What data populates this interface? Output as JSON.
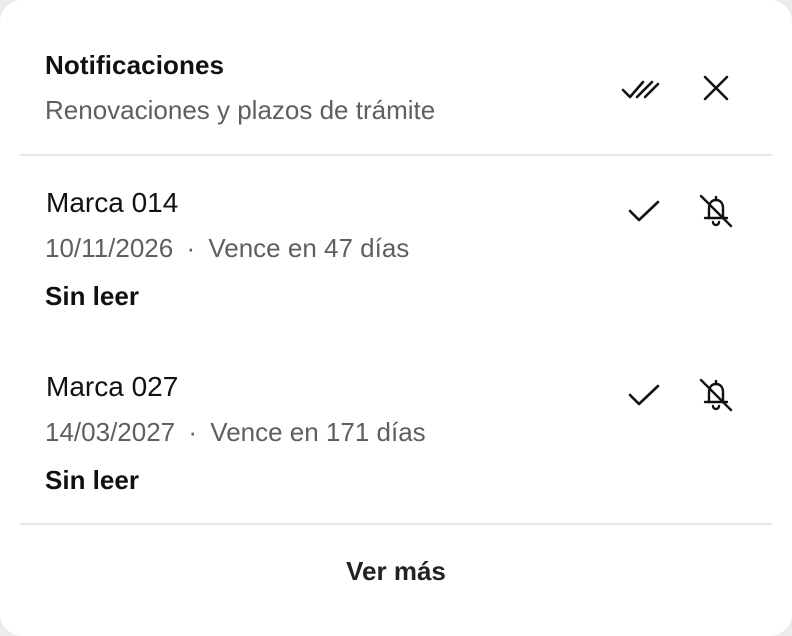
{
  "header": {
    "title": "Notificaciones",
    "subtitle": "Renovaciones y plazos de trámite",
    "actions": [
      {
        "name": "mark-all-read",
        "icon": "double-check-icon"
      },
      {
        "name": "close",
        "icon": "close-icon"
      }
    ]
  },
  "notifications": [
    {
      "title": "Marca 014",
      "date": "10/11/2026",
      "separator": "·",
      "due": "Vence en 47 días",
      "status": "Sin leer"
    },
    {
      "title": "Marca 027",
      "date": "14/03/2027",
      "separator": "·",
      "due": "Vence en 171 días",
      "status": "Sin leer"
    }
  ],
  "footer": {
    "more_label": "Ver más"
  },
  "colors": {
    "text_primary": "#111111",
    "text_secondary": "#5f5f5f",
    "divider": "#e6e6e6",
    "background": "#ffffff"
  }
}
